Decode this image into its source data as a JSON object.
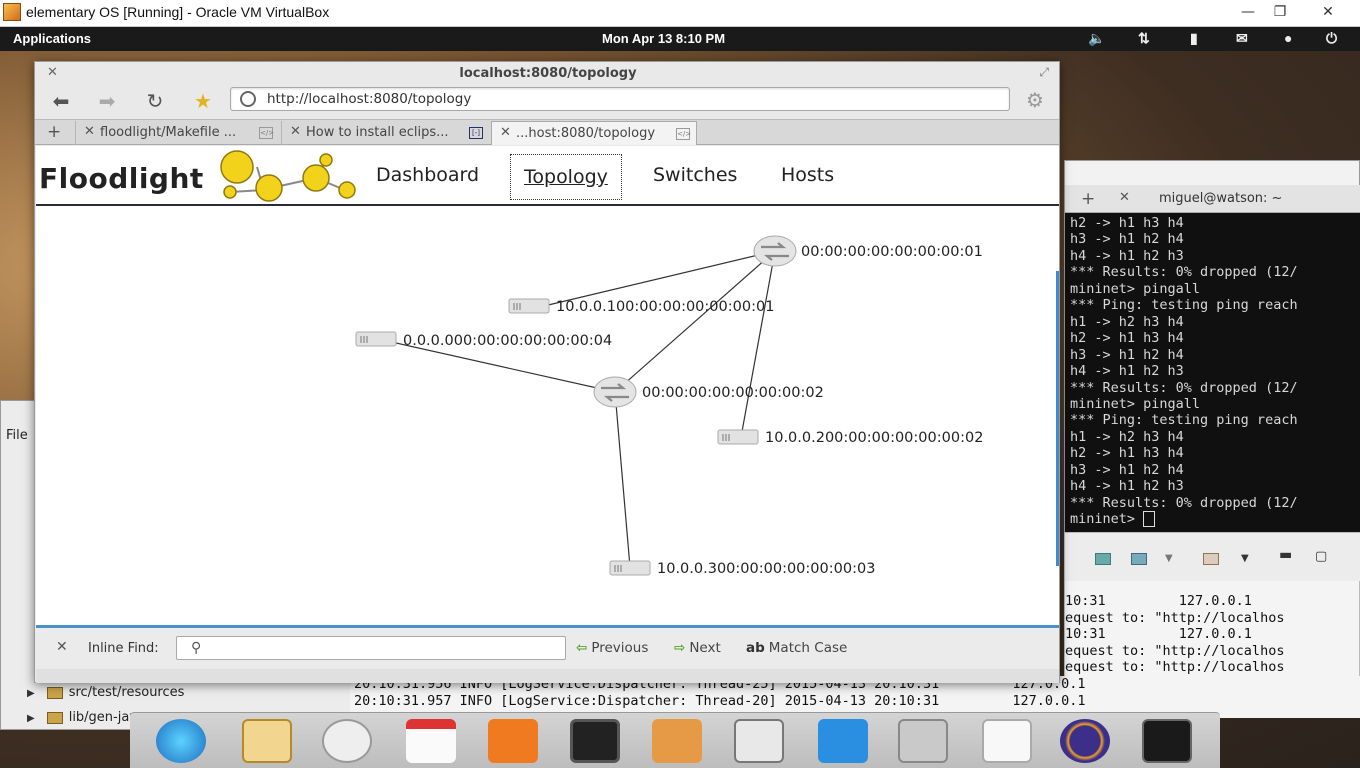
{
  "vbox": {
    "title": "elementary OS [Running] - Oracle VM VirtualBox"
  },
  "panel": {
    "applications": "Applications",
    "clock": "Mon Apr 13  8:10 PM"
  },
  "browser": {
    "window_title": "localhost:8080/topology",
    "url": "http://localhost:8080/topology",
    "tabs": [
      {
        "label": "floodlight/Makefile ..."
      },
      {
        "label": "How to install eclips..."
      },
      {
        "label": "...host:8080/topology"
      }
    ],
    "find": {
      "label": "Inline Find:",
      "value": "",
      "previous": "Previous",
      "next": "Next",
      "match_case": "Match Case"
    }
  },
  "page": {
    "logo": "Floodlight",
    "nav": [
      {
        "label": "Dashboard"
      },
      {
        "label": "Topology"
      },
      {
        "label": "Switches"
      },
      {
        "label": "Hosts"
      }
    ]
  },
  "topology": {
    "switches": [
      {
        "id": "00:00:00:00:00:00:00:01"
      },
      {
        "id": "00:00:00:00:00:00:00:02"
      }
    ],
    "hosts": [
      {
        "label": "10.0.0.100:00:00:00:00:00:01"
      },
      {
        "label": "0.0.0.000:00:00:00:00:00:04"
      },
      {
        "label": "10.0.0.200:00:00:00:00:00:02"
      },
      {
        "label": "10.0.0.300:00:00:00:00:00:03"
      }
    ]
  },
  "terminal": {
    "title": "miguel@watson: ~",
    "lines": [
      "h2 -> h1 h3 h4",
      "h3 -> h1 h2 h4",
      "h4 -> h1 h2 h3",
      "*** Results: 0% dropped (12/",
      "mininet> pingall",
      "*** Ping: testing ping reach",
      "h1 -> h2 h3 h4",
      "h2 -> h1 h3 h4",
      "h3 -> h1 h2 h4",
      "h4 -> h1 h2 h3",
      "*** Results: 0% dropped (12/",
      "mininet> pingall",
      "*** Ping: testing ping reach",
      "h1 -> h2 h3 h4",
      "h2 -> h1 h3 h4",
      "h3 -> h1 h2 h4",
      "h4 -> h1 h2 h3",
      "*** Results: 0% dropped (12/",
      "mininet> "
    ]
  },
  "console": {
    "lines": [
      "10:31         127.0.0.1",
      "equest to: \"http://localhos",
      "10:31         127.0.0.1",
      "equest to: \"http://localhos",
      "equest to: \"http://localhos",
      "10:31         127.0.0.1"
    ],
    "bottom_lines": [
      "20:10:31.956 INFO [LogService:Dispatcher: Thread-25] 2015-04-13 20:10:31         127.0.0.1",
      "20:10:31.957 INFO [LogService:Dispatcher: Thread-20] 2015-04-13 20:10:31         127.0.0.1"
    ]
  },
  "eclipse": {
    "file_menu": "File",
    "tree": [
      "src/test/resources",
      "lib/gen-java"
    ]
  }
}
